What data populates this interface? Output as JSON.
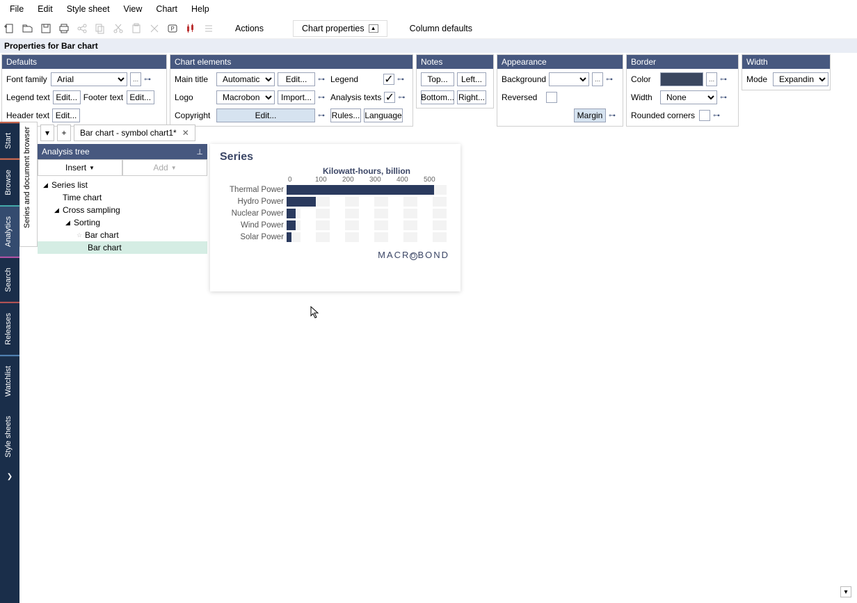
{
  "menu": {
    "file": "File",
    "edit": "Edit",
    "stylesheet": "Style sheet",
    "view": "View",
    "chart": "Chart",
    "help": "Help"
  },
  "toolbar": {
    "actions": "Actions",
    "chartprops": "Chart properties",
    "coldef": "Column defaults"
  },
  "propbar": "Properties for Bar chart",
  "defaults": {
    "title": "Defaults",
    "fontfamily": "Font family",
    "fontfamily_val": "Arial",
    "legendtext": "Legend text",
    "legend_edit": "Edit...",
    "footertext": "Footer text",
    "footer_edit": "Edit...",
    "headertext": "Header text",
    "header_edit": "Edit...",
    "dots": "..."
  },
  "chartel": {
    "title": "Chart elements",
    "maintitle": "Main title",
    "maintitle_val": "Automatic",
    "maintitle_edit": "Edit...",
    "legend": "Legend",
    "logo": "Logo",
    "logo_val": "Macrobond",
    "logo_import": "Import...",
    "analysistexts": "Analysis texts",
    "copyright": "Copyright",
    "copy_edit": "Edit...",
    "rules": "Rules...",
    "language": "Language"
  },
  "notes": {
    "title": "Notes",
    "top": "Top...",
    "left": "Left...",
    "bottom": "Bottom...",
    "right": "Right..."
  },
  "appearance": {
    "title": "Appearance",
    "background": "Background",
    "reversed": "Reversed",
    "margin": "Margin",
    "dots": "..."
  },
  "border": {
    "title": "Border",
    "color": "Color",
    "width": "Width",
    "width_val": "None",
    "rounded": "Rounded corners",
    "dots": "..."
  },
  "width": {
    "title": "Width",
    "mode": "Mode",
    "mode_val": "Expanding"
  },
  "lefttabs": {
    "start": "Start",
    "browse": "Browse",
    "analytics": "Analytics",
    "search": "Search",
    "releases": "Releases",
    "watchlist": "Watchlist",
    "stylesheets": "Style sheets"
  },
  "docstrip": "Series and document browser",
  "tabbar": {
    "tabname": "Bar chart - symbol chart1*"
  },
  "tree": {
    "title": "Analysis tree",
    "insert": "Insert",
    "add": "Add",
    "n0": "Series list",
    "n1": "Time chart",
    "n2": "Cross sampling",
    "n3": "Sorting",
    "n4": "Bar chart",
    "n5": "Bar chart"
  },
  "chart": {
    "series_title": "Series",
    "subtitle": "Kilowatt-hours, billion",
    "brand": "MACROBOND"
  },
  "chart_data": {
    "type": "bar",
    "orientation": "horizontal",
    "title": "Series",
    "subtitle": "Kilowatt-hours, billion",
    "categories": [
      "Thermal Power",
      "Hydro Power",
      "Nuclear Power",
      "Wind Power",
      "Solar Power"
    ],
    "values": [
      475,
      95,
      30,
      30,
      15
    ],
    "xlabel": "Kilowatt-hours, billion",
    "xlim": [
      0,
      530
    ],
    "xticks": [
      0,
      100,
      200,
      300,
      400,
      500
    ]
  }
}
